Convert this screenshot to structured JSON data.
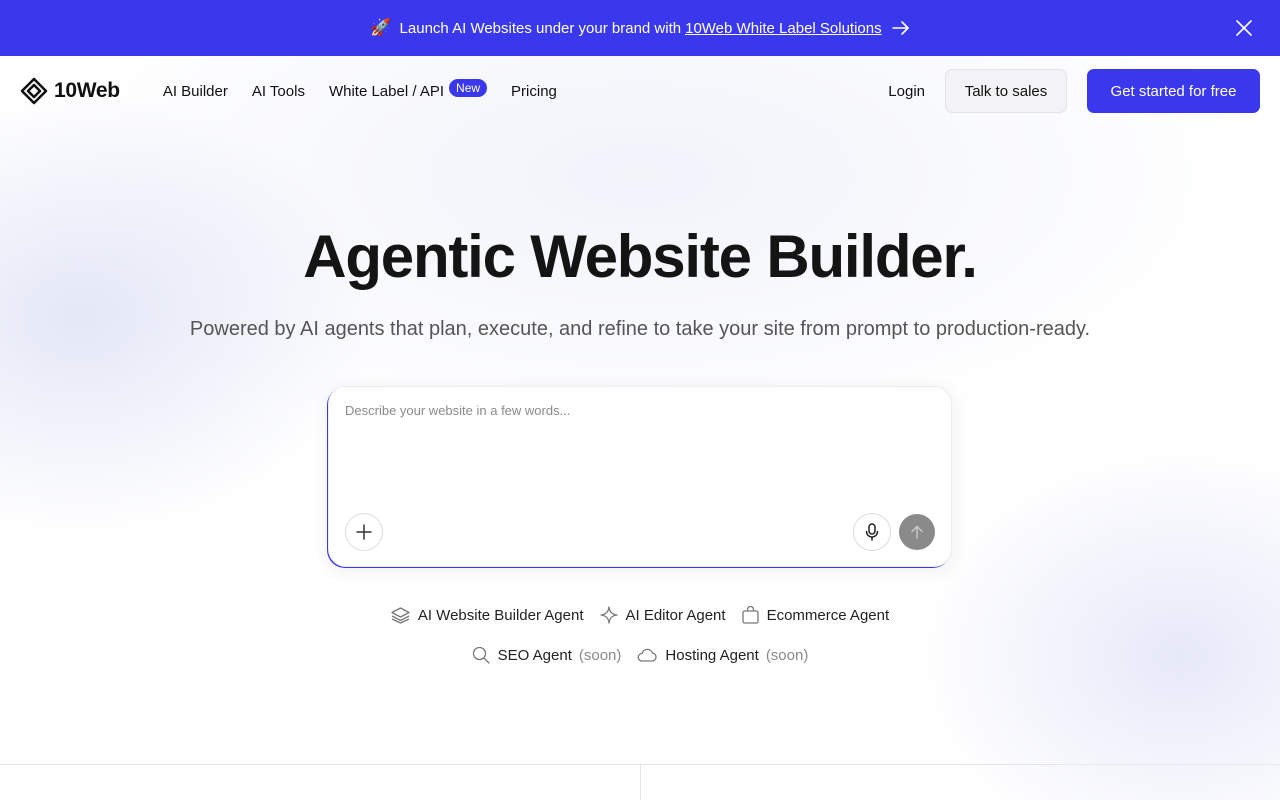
{
  "announcement": {
    "text": "Launch AI Websites under your brand with",
    "link": "10Web White Label Solutions",
    "rocket": "🚀"
  },
  "header": {
    "logo_text": "10Web",
    "nav": [
      {
        "label": "AI Builder"
      },
      {
        "label": "AI Tools"
      },
      {
        "label": "White Label / API",
        "badge": "New"
      },
      {
        "label": "Pricing"
      }
    ],
    "login": "Login",
    "talk_to_sales": "Talk to sales",
    "get_started": "Get started for free"
  },
  "hero": {
    "title": "Agentic Website Builder.",
    "subtitle": "Powered by AI agents that plan, execute, and refine to take your site from prompt to production-ready."
  },
  "prompt": {
    "placeholder": "Describe your website in a few words..."
  },
  "agents": {
    "row1": [
      {
        "label": "AI Website Builder Agent",
        "icon": "layers-icon"
      },
      {
        "label": "AI Editor Agent",
        "icon": "sparkle-icon"
      },
      {
        "label": "Ecommerce Agent",
        "icon": "shopping-bag-icon"
      }
    ],
    "row2": [
      {
        "label": "SEO Agent",
        "soon": "(soon)",
        "icon": "search-icon"
      },
      {
        "label": "Hosting Agent",
        "soon": "(soon)",
        "icon": "cloud-icon"
      }
    ]
  },
  "colors": {
    "brand": "#3a38ec",
    "send_button": "#8a8a8a"
  }
}
